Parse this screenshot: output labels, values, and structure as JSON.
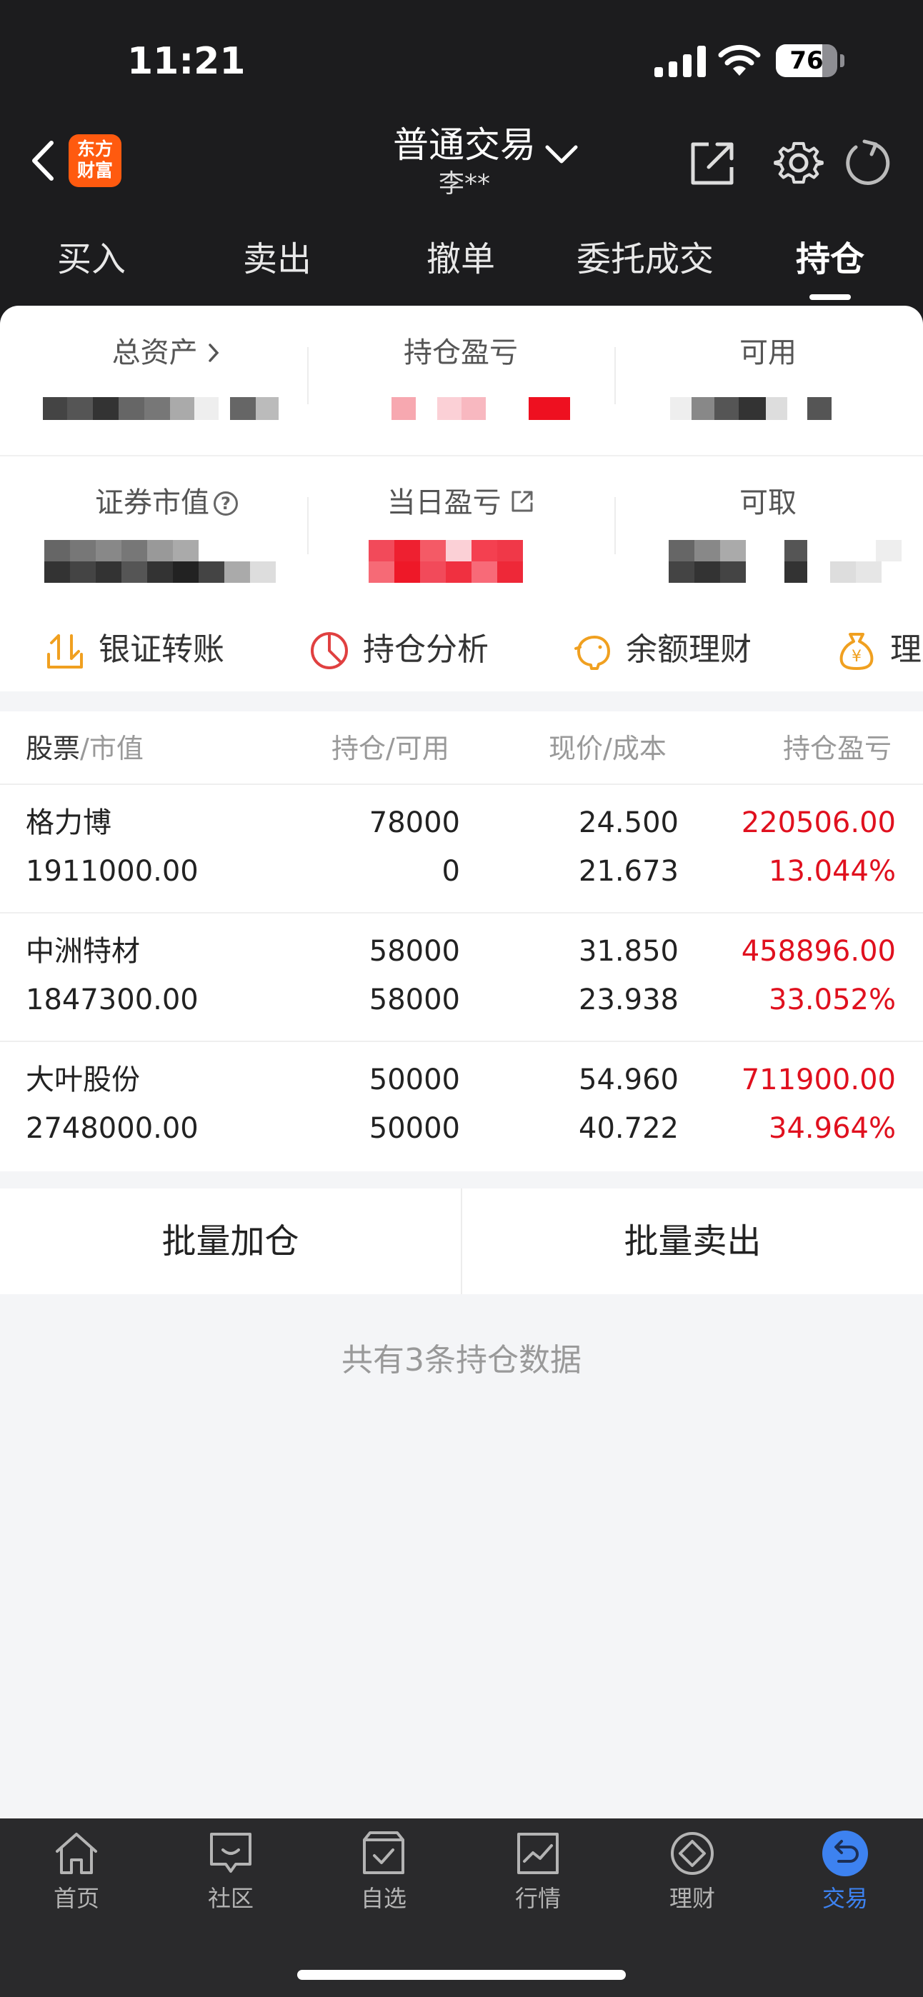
{
  "status_bar": {
    "time": "11:21",
    "battery": "76",
    "battery_level": 0.76
  },
  "header": {
    "logo_text_line1": "东方",
    "logo_text_line2": "财富",
    "title": "普通交易",
    "account_name": "李**"
  },
  "tabs": [
    {
      "label": "买入"
    },
    {
      "label": "卖出"
    },
    {
      "label": "撤单"
    },
    {
      "label": "委托成交"
    },
    {
      "label": "持仓",
      "active": true
    }
  ],
  "summary": {
    "total_assets_label": "总资产",
    "position_pnl_label": "持仓盈亏",
    "available_label": "可用",
    "market_value_label": "证券市值",
    "today_pnl_label": "当日盈亏",
    "withdrawable_label": "可取"
  },
  "quick_actions": [
    {
      "label": "银证转账",
      "icon": "transfer-icon"
    },
    {
      "label": "持仓分析",
      "icon": "pie-chart-icon"
    },
    {
      "label": "余额理财",
      "icon": "piggy-bank-icon"
    },
    {
      "label": "理财",
      "icon": "money-bag-icon"
    }
  ],
  "table": {
    "headers": {
      "stock": "股票",
      "market_value": "/市值",
      "position": "持仓",
      "available": "/可用",
      "price": "现价",
      "cost": "/成本",
      "pnl": "持仓盈亏"
    },
    "rows": [
      {
        "name": "格力博",
        "market_value": "1911000.00",
        "position": "78000",
        "available": "0",
        "price": "24.500",
        "cost": "21.673",
        "pnl": "220506.00",
        "pnl_pct": "13.044%"
      },
      {
        "name": "中洲特材",
        "market_value": "1847300.00",
        "position": "58000",
        "available": "58000",
        "price": "31.850",
        "cost": "23.938",
        "pnl": "458896.00",
        "pnl_pct": "33.052%"
      },
      {
        "name": "大叶股份",
        "market_value": "2748000.00",
        "position": "50000",
        "available": "50000",
        "price": "54.960",
        "cost": "40.722",
        "pnl": "711900.00",
        "pnl_pct": "34.964%"
      }
    ]
  },
  "batch": {
    "add_label": "批量加仓",
    "sell_label": "批量卖出"
  },
  "count_text": "共有3条持仓数据",
  "bottom_nav": [
    {
      "label": "首页",
      "icon": "home-icon"
    },
    {
      "label": "社区",
      "icon": "community-icon"
    },
    {
      "label": "自选",
      "icon": "watchlist-icon"
    },
    {
      "label": "行情",
      "icon": "market-icon"
    },
    {
      "label": "理财",
      "icon": "finance-icon"
    },
    {
      "label": "交易",
      "icon": "trade-icon",
      "active": true
    }
  ],
  "colors": {
    "accent_red": "#e0101e",
    "brand_orange": "#ff5a0f",
    "active_blue": "#3d82f0",
    "action_icon_orange": "#f0a020"
  }
}
